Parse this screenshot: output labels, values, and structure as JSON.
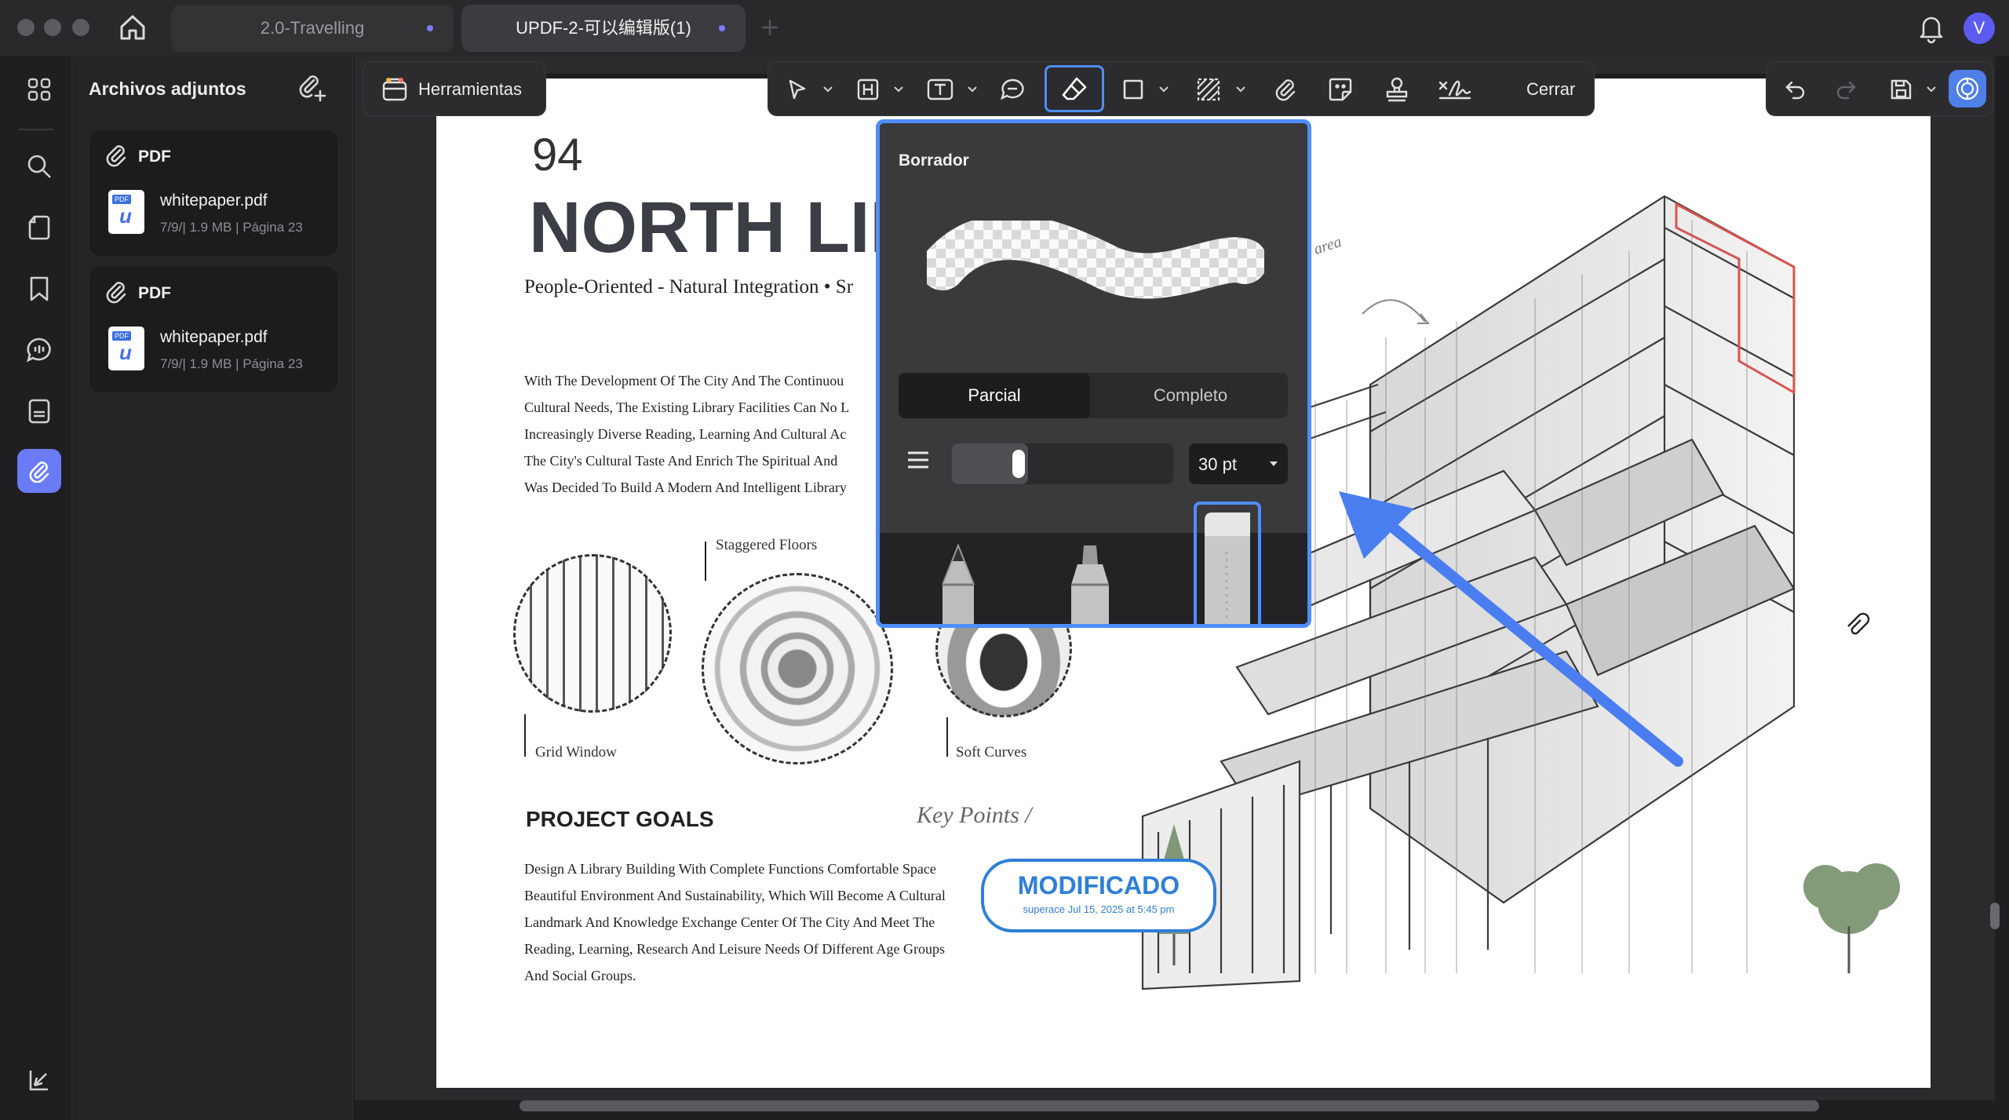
{
  "window": {
    "tabs": [
      {
        "label": "2.0-Travelling",
        "active": false
      },
      {
        "label": "UPDF-2-可以编辑版(1)",
        "active": true
      }
    ],
    "avatar_letter": "V"
  },
  "sidebar": {
    "title": "Archivos adjuntos",
    "attachments": [
      {
        "type": "PDF",
        "filename": "whitepaper.pdf",
        "meta": "7/9/| 1.9 MB | Página 23"
      },
      {
        "type": "PDF",
        "filename": "whitepaper.pdf",
        "meta": "7/9/| 1.9 MB | Página 23"
      }
    ]
  },
  "toolbar": {
    "tools_label": "Herramientas",
    "close_label": "Cerrar"
  },
  "eraser_popup": {
    "title": "Borrador",
    "mode_options": [
      "Parcial",
      "Completo"
    ],
    "selected_mode": "Parcial",
    "size_value": "30 pt",
    "size_level": 0.3
  },
  "document": {
    "page_number": "94",
    "heading": "NORTH LIB",
    "subheading": "People-Oriented - Natural Integration • Sr",
    "intro_lines": [
      "With The Development Of The City And The Continuou",
      "Cultural Needs, The Existing Library Facilities Can No L",
      "Increasingly Diverse Reading, Learning And Cultural Ac",
      "The City's Cultural Taste And Enrich The Spiritual And",
      "Was Decided To Build A Modern And Intelligent Library"
    ],
    "labels": {
      "staggered": "Staggered Floors",
      "grid": "Grid Window",
      "soft": "Soft Curves",
      "area": "area"
    },
    "goals_heading": "PROJECT GOALS",
    "goals_lines": [
      "Design A Library Building With Complete Functions Comfortable Space",
      "Beautiful Environment And Sustainability, Which Will Become A Cultural",
      "Landmark And Knowledge Exchange Center Of The City And Meet The",
      "Reading, Learning, Research And Leisure Needs Of Different Age Groups",
      "And Social Groups."
    ],
    "key_points": "Key Points /",
    "stamp": {
      "title": "MODIFICADO",
      "subtitle": "superace Jul 15, 2025 at 5:45 pm"
    }
  },
  "colors": {
    "accent": "#4f8dff",
    "arrow": "#4a7ef0",
    "stamp": "#2f7fd8",
    "rail_active": "#6a7cf5"
  }
}
